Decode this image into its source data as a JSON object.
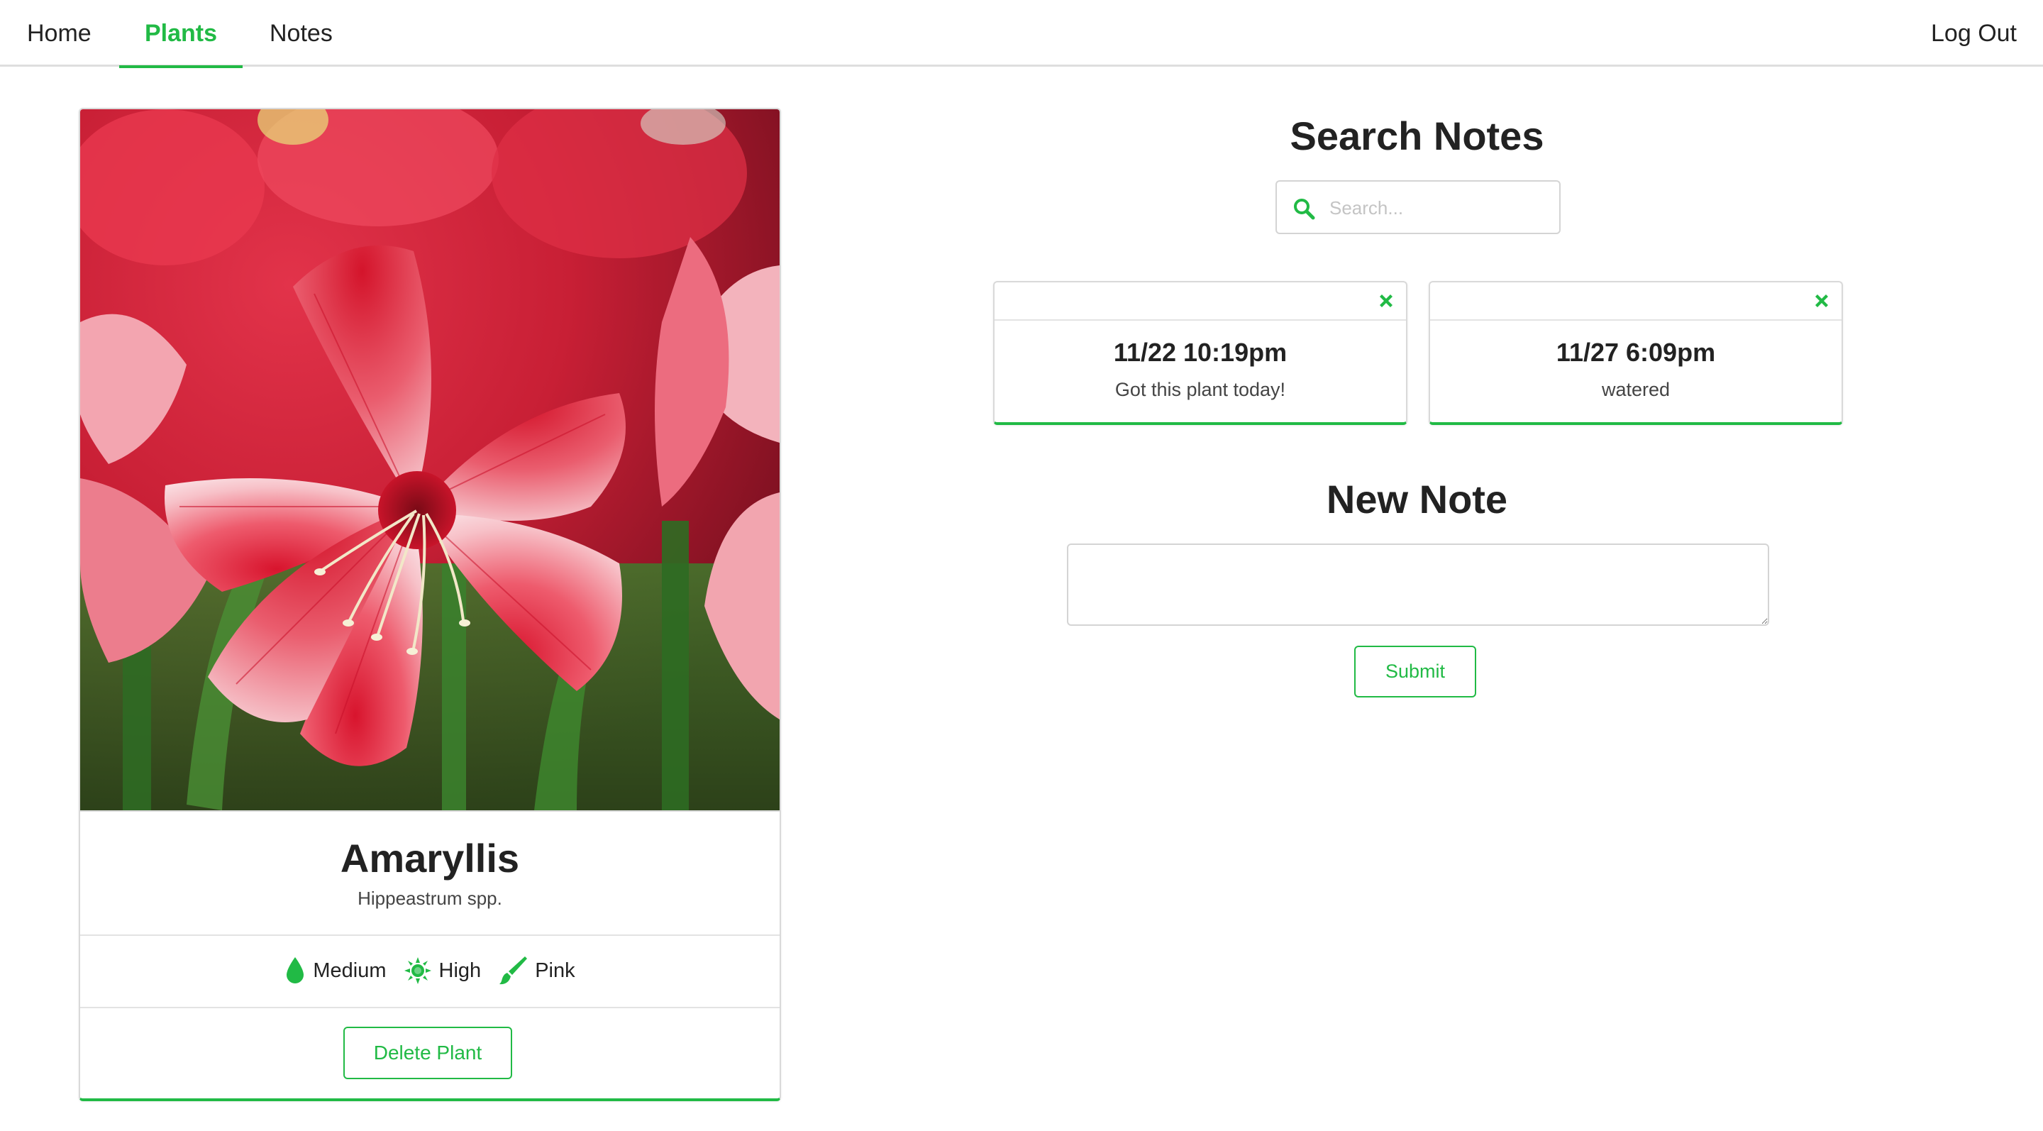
{
  "nav": {
    "home": "Home",
    "plants": "Plants",
    "notes": "Notes",
    "logout": "Log Out",
    "active": "Plants"
  },
  "plant": {
    "name": "Amaryllis",
    "scientific_name": "Hippeastrum spp.",
    "water": {
      "label": "Medium",
      "icon": "water-drop-icon"
    },
    "sun": {
      "label": "High",
      "icon": "sun-icon"
    },
    "color": {
      "label": "Pink",
      "icon": "paintbrush-icon"
    },
    "delete_label": "Delete Plant"
  },
  "search": {
    "title": "Search Notes",
    "placeholder": "Search...",
    "icon": "search-icon"
  },
  "notes": [
    {
      "time": "11/22 10:19pm",
      "text": "Got this plant today!"
    },
    {
      "time": "11/27 6:09pm",
      "text": "watered"
    }
  ],
  "new_note": {
    "title": "New Note",
    "value": "",
    "submit_label": "Submit"
  },
  "colors": {
    "accent": "#21ba45",
    "text": "#222222",
    "border": "#d9d9d9"
  }
}
